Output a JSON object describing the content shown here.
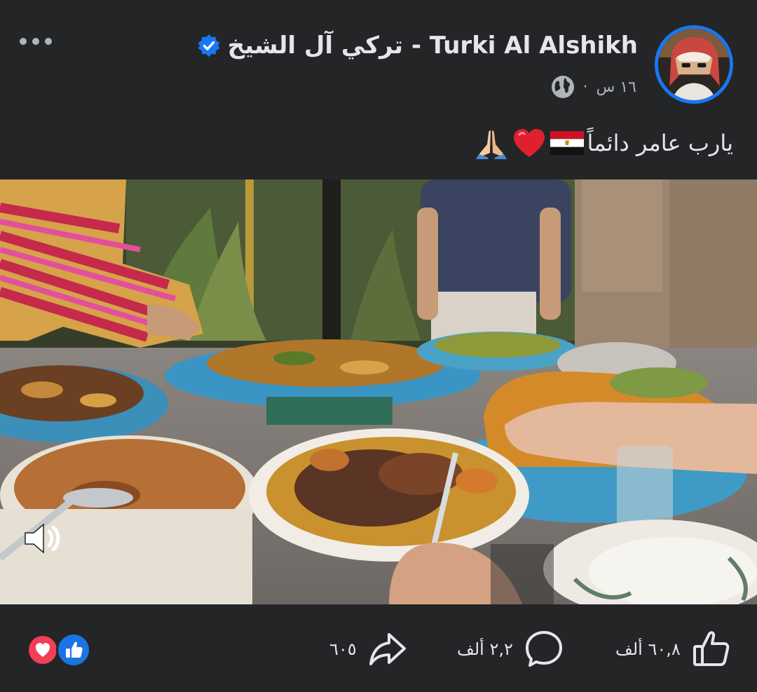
{
  "post": {
    "author_name": "تركي آل الشيخ - Turki Al Alshikh",
    "time": "١٦ س",
    "separator": "·",
    "caption_text": "يارب عامر دائماً"
  },
  "icons": {
    "more": "more-options-icon",
    "verified": "verified-badge-icon",
    "audience": "globe-icon",
    "caption_emoji": [
      "egypt-flag-icon",
      "red-heart-icon",
      "folded-hands-icon"
    ],
    "volume": "volume-icon",
    "reactions": [
      "love-reaction-icon",
      "like-reaction-icon"
    ],
    "actions": [
      "share-icon",
      "comment-icon",
      "like-icon"
    ]
  },
  "stats": {
    "likes": "٦٠,٨ ألف",
    "comments": "٢,٢ ألف",
    "shares": "٦٠٥"
  },
  "colors": {
    "background": "#242526",
    "text": "#e4e6eb",
    "secondary_text": "#b0b3b8",
    "accent": "#1877f2",
    "love": "#f33e58",
    "like": "#1b74e4"
  }
}
